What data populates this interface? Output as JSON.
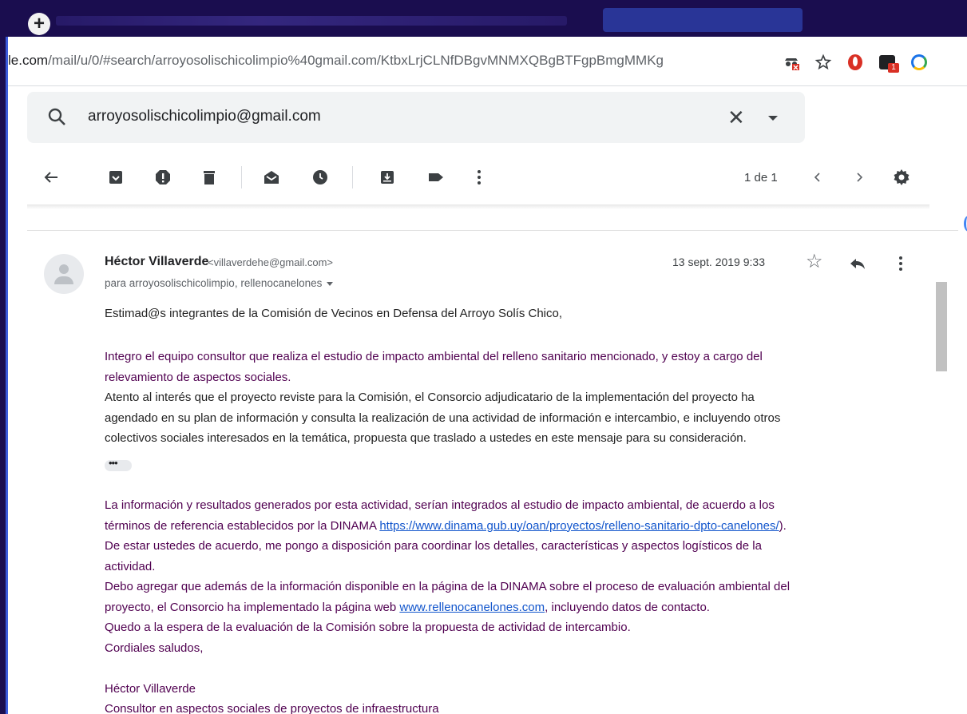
{
  "browser": {
    "new_tab_label": "+",
    "url_host": "le.com",
    "url_path": "/mail/u/0/#search/arroyosolischicolimpio%40gmail.com/KtbxLrjCLNfDBgvMNMXQBgBTFgpBmgMMKg",
    "extension_badge": "1",
    "icons": [
      "incognito-translate-icon",
      "bookmark-star-icon",
      "adblock-icon",
      "extension-icon",
      "chrome-sync-icon"
    ]
  },
  "search": {
    "value": "arroyosolischicolimpio@gmail.com"
  },
  "toolbar": {
    "pager": "1 de 1",
    "actions": [
      "back",
      "archive",
      "report-spam",
      "delete",
      "mark-unread",
      "snooze",
      "move-to",
      "labels",
      "more"
    ]
  },
  "email": {
    "sender_name": "Héctor Villaverde",
    "sender_email": "<villaverdehe@gmail.com>",
    "recipients": "para arroyosolischicolimpio, rellenocanelones",
    "date": "13 sept. 2019 9:33",
    "greeting": "Estimad@s integrantes de la Comisión de Vecinos en Defensa del Arroyo Solís Chico,",
    "p1_line1": "Integro el equipo consultor que realiza el estudio de impacto ambiental del relleno sanitario mencionado, y estoy a cargo del",
    "p1_line2": "relevamiento de aspectos sociales.",
    "p2_line1": "Atento al interés que el proyecto reviste para la Comisión, el Consorcio adjudicatario de la implementación del proyecto ha",
    "p2_line2": "agendado en su plan de información y consulta la realización de una actividad de información e intercambio, e incluyendo otros",
    "p2_line3": "colectivos sociales interesados en la temática, propuesta que traslado a ustedes en este mensaje para su consideración.",
    "p3_line1": "La información y resultados generados por esta actividad, serían integrados al estudio de impacto ambiental, de acuerdo a los",
    "p3_line2_pre": "términos de referencia establecidos por la DINAMA ",
    "p3_link": "https://www.dinama.gub.uy/oan/proyectos/relleno-sanitario-dpto-canelones/",
    "p3_line2_post": ").",
    "p4_line1": "De estar ustedes de acuerdo, me pongo a disposición para coordinar los detalles, características y aspectos logísticos de la",
    "p4_line2": "actividad.",
    "p5_line1": "Debo agregar que además de la información disponible en la página de la DINAMA sobre el proceso de evaluación ambiental del",
    "p5_line2_pre": "proyecto, el Consorcio ha implementado la página web ",
    "p5_link": "www.rellenocanelones.com",
    "p5_line2_post": ", incluyendo datos de contacto.",
    "p6": "Quedo a la espera de la evaluación de la Comisión sobre la propuesta de actividad de intercambio.",
    "closing": "Cordiales saludos,",
    "sig_name": "Héctor Villaverde",
    "sig_title": "Consultor en aspectos sociales de proyectos de infraestructura"
  },
  "colors": {
    "tabbar": "#1a0d4f",
    "quoted_text": "#500050",
    "link": "#1155cc",
    "search_bg": "#f1f3f4"
  }
}
